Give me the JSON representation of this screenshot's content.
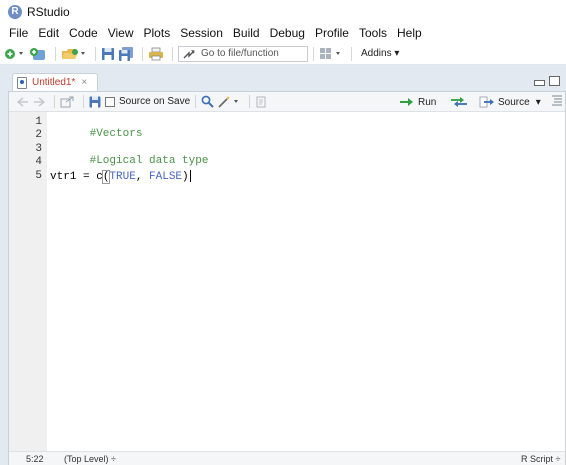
{
  "window": {
    "title": "RStudio",
    "logo_letter": "R"
  },
  "menu": [
    "File",
    "Edit",
    "Code",
    "View",
    "Plots",
    "Session",
    "Build",
    "Debug",
    "Profile",
    "Tools",
    "Help"
  ],
  "toolbar": {
    "goto_placeholder": "Go to file/function",
    "addins_label": "Addins",
    "dropdown_glyph": "▾"
  },
  "editor_tab": {
    "label": "Untitled1*",
    "close_glyph": "×"
  },
  "editor_toolbar": {
    "source_on_save_label": "Source on Save",
    "run_label": "Run",
    "source_label": "Source",
    "dropdown_glyph": "▾"
  },
  "code": {
    "lines": [
      {
        "number": "1",
        "tokens": [
          {
            "text": "#Vectors",
            "kind": "comment"
          }
        ]
      },
      {
        "number": "2",
        "tokens": []
      },
      {
        "number": "3",
        "tokens": [
          {
            "text": "#Logical data type",
            "kind": "comment"
          }
        ]
      },
      {
        "number": "4",
        "tokens": []
      },
      {
        "number": "5",
        "tokens": [
          {
            "text": "vtr1 = c",
            "kind": "ident"
          },
          {
            "text": "(",
            "kind": "paren-hl"
          },
          {
            "text": "TRUE",
            "kind": "const"
          },
          {
            "text": ", ",
            "kind": "ident"
          },
          {
            "text": "FALSE",
            "kind": "const"
          },
          {
            "text": ")",
            "kind": "paren-hl"
          }
        ]
      }
    ]
  },
  "status": {
    "position": "5:22",
    "scope": "(Top Level) ÷",
    "file_type": "R Script ÷"
  },
  "colors": {
    "comment": "#4a9448",
    "constant": "#4766c4",
    "tab_label": "#c0392b",
    "run_arrow": "#2f9e44"
  }
}
